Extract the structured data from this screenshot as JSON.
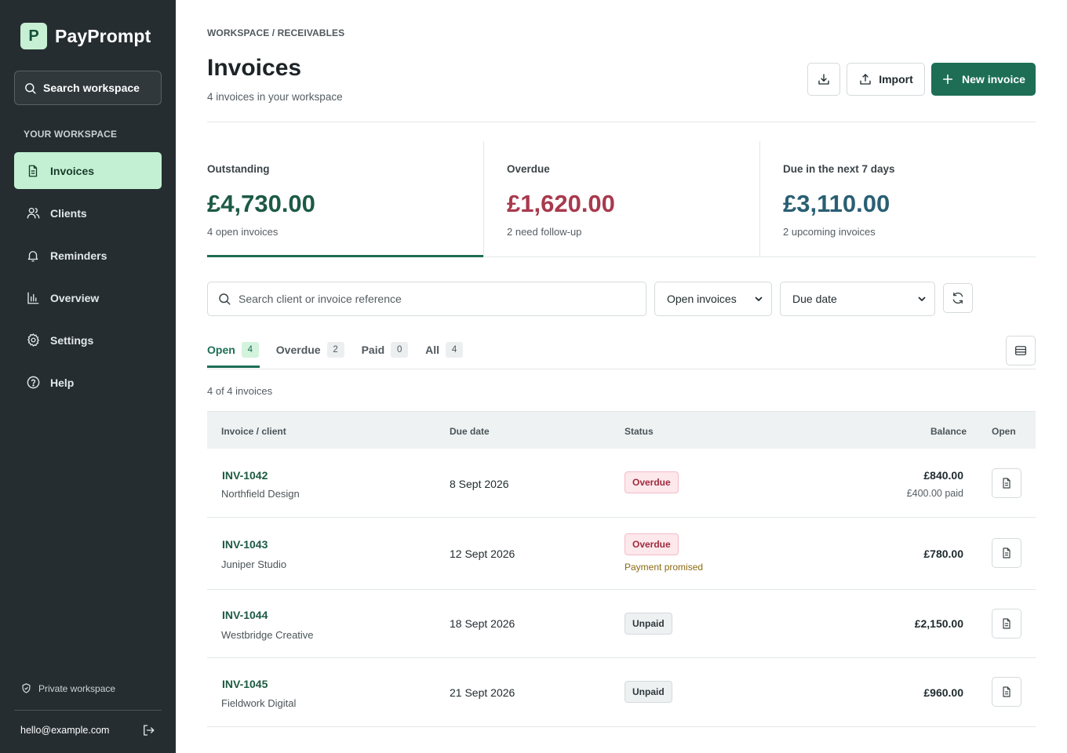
{
  "sidebar": {
    "brand_letter": "P",
    "brand_name": "PayPrompt",
    "search_label": "Search workspace",
    "section_heading": "YOUR WORKSPACE",
    "items": [
      {
        "label": "Invoices",
        "icon": "document-icon",
        "active": true
      },
      {
        "label": "Clients",
        "icon": "users-icon",
        "active": false
      },
      {
        "label": "Reminders",
        "icon": "bell-icon",
        "active": false
      },
      {
        "label": "Overview",
        "icon": "bar-chart-icon",
        "active": false
      },
      {
        "label": "Settings",
        "icon": "gear-icon",
        "active": false
      },
      {
        "label": "Help",
        "icon": "help-circle-icon",
        "active": false
      }
    ],
    "privacy_label": "Private workspace",
    "user_email": "hello@example.com"
  },
  "header": {
    "breadcrumb": "WORKSPACE / RECEIVABLES",
    "title": "Invoices",
    "subtitle": "4 invoices in your workspace",
    "import_label": "Import",
    "new_invoice_label": "New invoice"
  },
  "metrics": [
    {
      "label": "Outstanding",
      "value": "£4,730.00",
      "sub": "4 open invoices",
      "color": "#1d5a45"
    },
    {
      "label": "Overdue",
      "value": "£1,620.00",
      "sub": "2 need follow-up",
      "color": "#a83a4e"
    },
    {
      "label": "Due in the next 7 days",
      "value": "£3,110.00",
      "sub": "2 upcoming invoices",
      "color": "#2a5f73"
    }
  ],
  "filters": {
    "search_placeholder": "Search client or invoice reference",
    "status_value": "Open invoices",
    "sort_value": "Due date"
  },
  "tabs": [
    {
      "label": "Open",
      "count": "4",
      "active": true
    },
    {
      "label": "Overdue",
      "count": "2",
      "active": false
    },
    {
      "label": "Paid",
      "count": "0",
      "active": false
    },
    {
      "label": "All",
      "count": "4",
      "active": false
    }
  ],
  "result_count": "4 of 4 invoices",
  "table": {
    "columns": {
      "invoice": "Invoice / client",
      "due": "Due date",
      "status": "Status",
      "balance": "Balance",
      "open": "Open"
    },
    "rows": [
      {
        "id": "INV-1042",
        "client": "Northfield Design",
        "due": "8 Sept 2026",
        "status": "Overdue",
        "status_type": "overdue",
        "note": "",
        "balance": "£840.00",
        "paid": "£400.00 paid"
      },
      {
        "id": "INV-1043",
        "client": "Juniper Studio",
        "due": "12 Sept 2026",
        "status": "Overdue",
        "status_type": "overdue",
        "note": "Payment promised",
        "balance": "£780.00",
        "paid": ""
      },
      {
        "id": "INV-1044",
        "client": "Westbridge Creative",
        "due": "18 Sept 2026",
        "status": "Unpaid",
        "status_type": "unpaid",
        "note": "",
        "balance": "£2,150.00",
        "paid": ""
      },
      {
        "id": "INV-1045",
        "client": "Fieldwork Digital",
        "due": "21 Sept 2026",
        "status": "Unpaid",
        "status_type": "unpaid",
        "note": "",
        "balance": "£960.00",
        "paid": ""
      }
    ]
  }
}
